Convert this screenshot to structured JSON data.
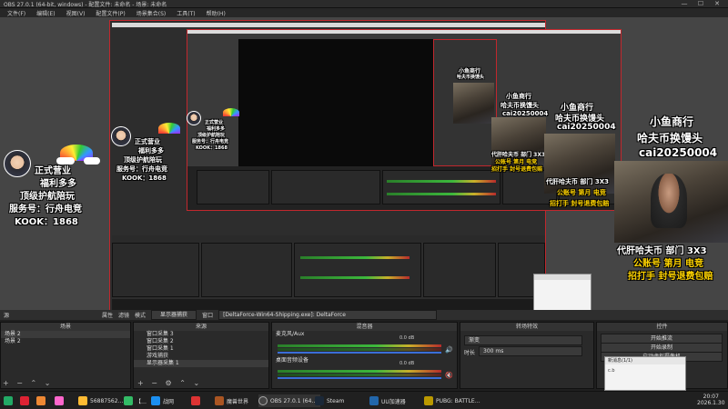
{
  "window": {
    "title": "OBS 27.0.1 (64-bit, windows) - 配置文件: 未命名 - 场景: 未命名",
    "controls": [
      "—",
      "☐",
      "✕"
    ]
  },
  "menu": [
    "文件(F)",
    "编辑(E)",
    "视图(V)",
    "配置文件(P)",
    "场景集合(S)",
    "工具(T)",
    "帮助(H)"
  ],
  "overlay": {
    "badge_line1": "正式营业",
    "badge_line2": "福利多多",
    "badge_line3": "顶级护航陪玩",
    "badge_service": "服务号：行舟电竞",
    "badge_kook": "KOOK：1868",
    "promo_line1": "小鱼商行",
    "promo_line2": "哈夫币换馒头",
    "promo_line3": "cai20250004",
    "bottom_line1": "代肝哈夫币 部门 3X3",
    "bottom_line2": "公账号 第月 电竞",
    "bottom_line3": "招打手 封号退费包赔"
  },
  "toolbar": {
    "source_label": "源",
    "properties": "属性",
    "filters": "滤镜",
    "mode": "模式",
    "mode_value": "显示器捕获",
    "window_label": "窗口",
    "window_value": "[DeltaForce-Win64-Shipping.exe]: DeltaForce"
  },
  "panels": {
    "scenes_header": "场景",
    "sources_header": "来源",
    "mixer_header": "混音器",
    "transitions_header": "转场特效",
    "controls_header": "控件",
    "scenes": [
      "场景 2",
      "场景 2"
    ],
    "sources": [
      "窗口采集 3",
      "窗口采集 2",
      "窗口采集 1",
      "游戏捕获",
      "显示器采集 1"
    ],
    "mixer_ch1": "麦克风/Aux",
    "mixer_ch1_level": "0.0 dB",
    "mixer_ch2": "桌面音频设备",
    "mixer_ch2_level": "0.0 dB",
    "transition_value": "渐变",
    "duration_label": "时长",
    "duration_value": "300 ms",
    "control_buttons": [
      "开始推流",
      "开始录制",
      "启动虚拟摄像机",
      "工作室模式",
      "设置",
      "退出"
    ]
  },
  "popup": {
    "title": "新消息(1/1)",
    "body": "c.b"
  },
  "taskbar": {
    "items": [
      {
        "label": "",
        "color": "#d23"
      },
      {
        "label": "",
        "color": "#e83"
      },
      {
        "label": "",
        "color": "#f6c"
      },
      {
        "label": "56887562…",
        "color": "#fb3"
      },
      {
        "label": "【…",
        "color": "#3b6"
      },
      {
        "label": "战网",
        "color": "#1b8ff0"
      },
      {
        "label": "",
        "color": "#d33"
      },
      {
        "label": "魔兽世界",
        "color": "#a52"
      },
      {
        "label": "OBS 27.0.1 (64…",
        "color": "#444"
      },
      {
        "label": "Steam",
        "color": "#1b2838"
      },
      {
        "label": "UU加速器",
        "color": "#26a"
      },
      {
        "label": "PUBG: BATTLE…",
        "color": "#b90"
      }
    ],
    "time": "20:07",
    "date": "2026.1.30"
  }
}
